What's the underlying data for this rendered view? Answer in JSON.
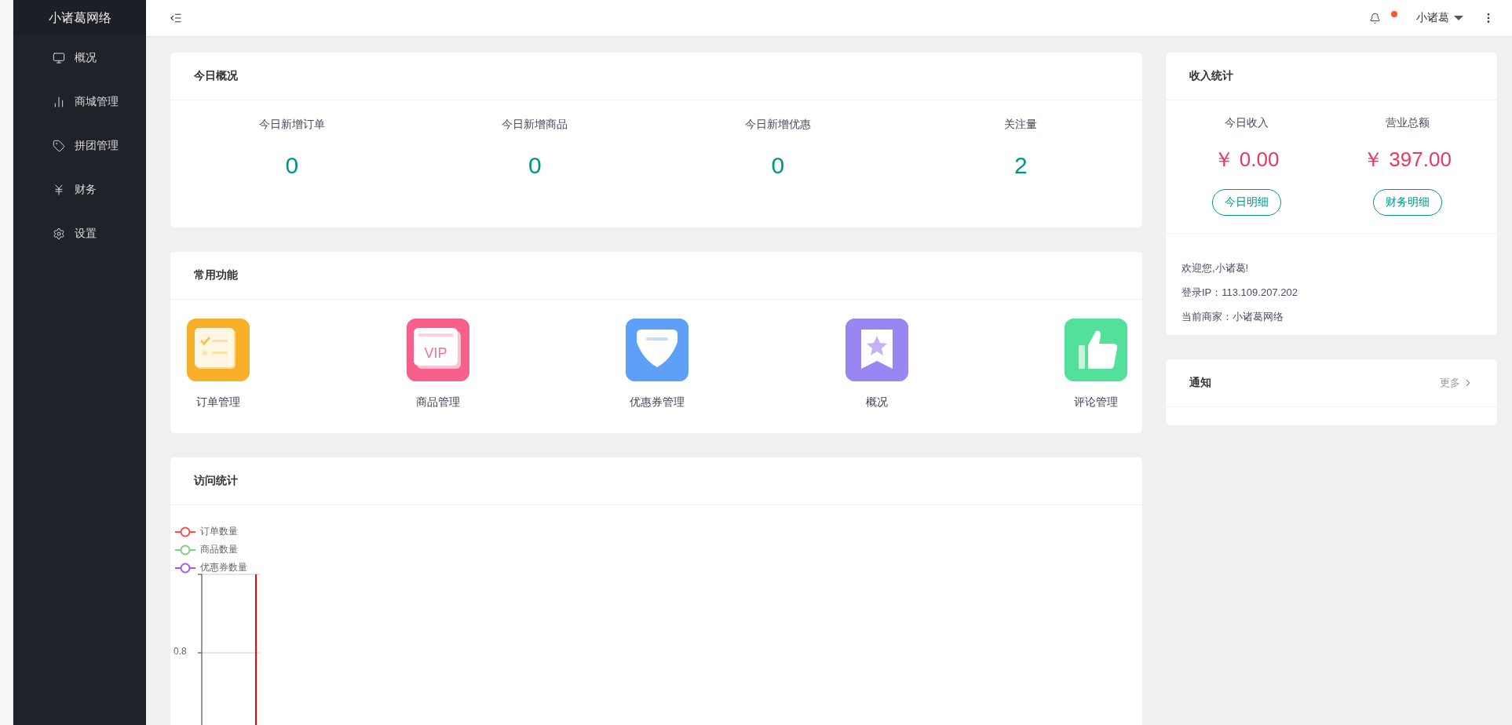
{
  "sidebar": {
    "logo": "小诸葛网络",
    "items": [
      {
        "label": "概况",
        "kind": "monitor"
      },
      {
        "label": "商城管理",
        "kind": "bars"
      },
      {
        "label": "拼团管理",
        "kind": "tag"
      },
      {
        "label": "财务",
        "kind": "yen"
      },
      {
        "label": "设置",
        "kind": "gear"
      }
    ]
  },
  "topbar": {
    "user": "小诸葛",
    "notification_dot": true
  },
  "today_overview": {
    "title": "今日概况",
    "stats": [
      {
        "label": "今日新增订单",
        "value": "0"
      },
      {
        "label": "今日新增商品",
        "value": "0"
      },
      {
        "label": "今日新增优惠",
        "value": "0"
      },
      {
        "label": "关注量",
        "value": "2"
      }
    ]
  },
  "functions": {
    "title": "常用功能",
    "items": [
      {
        "label": "订单管理",
        "kind": "list",
        "color": "#f8b02a"
      },
      {
        "label": "商品管理",
        "kind": "vip",
        "color": "#f7608a",
        "tile_text": "VIP"
      },
      {
        "label": "优惠券管理",
        "kind": "shield",
        "color": "#5ea0f8"
      },
      {
        "label": "概况",
        "kind": "star",
        "color": "#9a86f2"
      },
      {
        "label": "评论管理",
        "kind": "thumb",
        "color": "#52e09a"
      }
    ]
  },
  "visits": {
    "title": "访问统计",
    "legend": [
      {
        "label": "订单数量",
        "color": "#ff4d4f"
      },
      {
        "label": "商品数量",
        "color": "#7ed07e"
      },
      {
        "label": "优惠券数量",
        "color": "#a855f7"
      }
    ],
    "axis_tick": "0.8"
  },
  "income": {
    "title": "收入统计",
    "stats": [
      {
        "label": "今日收入",
        "amount": "￥ 0.00",
        "button": "今日明细"
      },
      {
        "label": "营业总额",
        "amount": "￥ 397.00",
        "button": "财务明细"
      }
    ],
    "lines": [
      "欢迎您,小诸葛!",
      "登录IP：113.109.207.202",
      "当前商家：小诸葛网络"
    ]
  },
  "notice": {
    "title": "通知",
    "more": "更多"
  }
}
